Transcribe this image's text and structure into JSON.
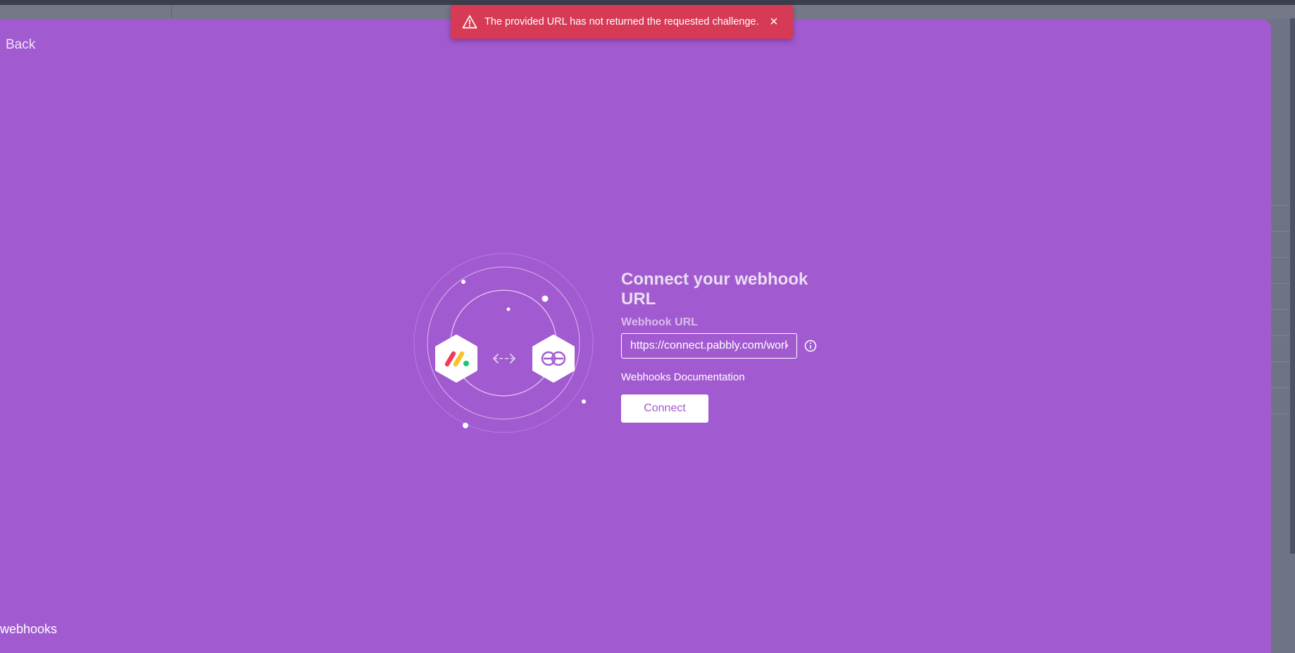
{
  "toast": {
    "message": "The provided URL has not returned the requested challenge.",
    "close_label": "×",
    "color": "#d63a55"
  },
  "nav": {
    "back_label": "Back"
  },
  "form": {
    "title": "Connect your webhook URL",
    "url_label": "Webhook URL",
    "url_value": "https://connect.pabbly.com/workflow",
    "docs_link": "Webhooks Documentation",
    "connect_label": "Connect"
  },
  "footer": {
    "brand_text": "webhooks"
  },
  "icons": {
    "toast": "warning-triangle-icon",
    "close": "close-icon",
    "info": "info-icon",
    "arrow": "bidirectional-arrow-icon",
    "left_app": "monday-logo-icon",
    "right_app": "webhooks-logo-icon"
  },
  "colors": {
    "modal_bg": "#a25ad0",
    "overlay_bg": "#6f7386"
  }
}
